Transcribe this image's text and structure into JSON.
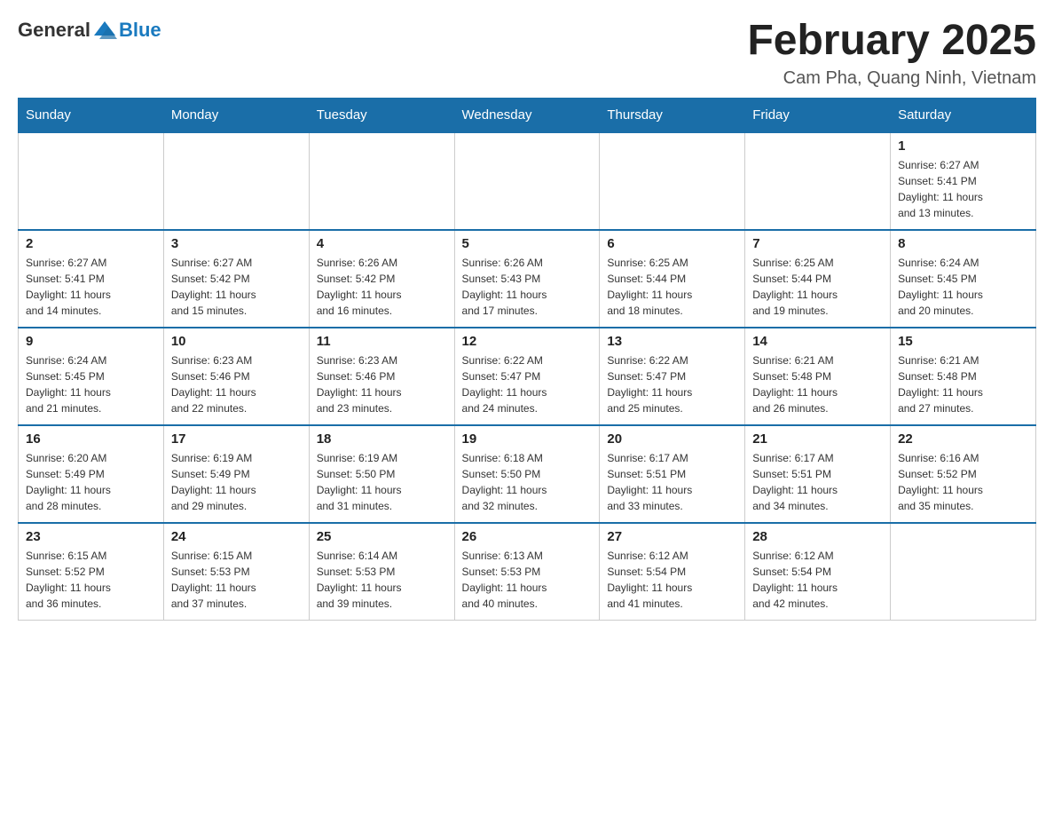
{
  "header": {
    "logo_general": "General",
    "logo_blue": "Blue",
    "month_title": "February 2025",
    "subtitle": "Cam Pha, Quang Ninh, Vietnam"
  },
  "weekdays": [
    "Sunday",
    "Monday",
    "Tuesday",
    "Wednesday",
    "Thursday",
    "Friday",
    "Saturday"
  ],
  "weeks": [
    [
      {
        "day": "",
        "info": ""
      },
      {
        "day": "",
        "info": ""
      },
      {
        "day": "",
        "info": ""
      },
      {
        "day": "",
        "info": ""
      },
      {
        "day": "",
        "info": ""
      },
      {
        "day": "",
        "info": ""
      },
      {
        "day": "1",
        "info": "Sunrise: 6:27 AM\nSunset: 5:41 PM\nDaylight: 11 hours\nand 13 minutes."
      }
    ],
    [
      {
        "day": "2",
        "info": "Sunrise: 6:27 AM\nSunset: 5:41 PM\nDaylight: 11 hours\nand 14 minutes."
      },
      {
        "day": "3",
        "info": "Sunrise: 6:27 AM\nSunset: 5:42 PM\nDaylight: 11 hours\nand 15 minutes."
      },
      {
        "day": "4",
        "info": "Sunrise: 6:26 AM\nSunset: 5:42 PM\nDaylight: 11 hours\nand 16 minutes."
      },
      {
        "day": "5",
        "info": "Sunrise: 6:26 AM\nSunset: 5:43 PM\nDaylight: 11 hours\nand 17 minutes."
      },
      {
        "day": "6",
        "info": "Sunrise: 6:25 AM\nSunset: 5:44 PM\nDaylight: 11 hours\nand 18 minutes."
      },
      {
        "day": "7",
        "info": "Sunrise: 6:25 AM\nSunset: 5:44 PM\nDaylight: 11 hours\nand 19 minutes."
      },
      {
        "day": "8",
        "info": "Sunrise: 6:24 AM\nSunset: 5:45 PM\nDaylight: 11 hours\nand 20 minutes."
      }
    ],
    [
      {
        "day": "9",
        "info": "Sunrise: 6:24 AM\nSunset: 5:45 PM\nDaylight: 11 hours\nand 21 minutes."
      },
      {
        "day": "10",
        "info": "Sunrise: 6:23 AM\nSunset: 5:46 PM\nDaylight: 11 hours\nand 22 minutes."
      },
      {
        "day": "11",
        "info": "Sunrise: 6:23 AM\nSunset: 5:46 PM\nDaylight: 11 hours\nand 23 minutes."
      },
      {
        "day": "12",
        "info": "Sunrise: 6:22 AM\nSunset: 5:47 PM\nDaylight: 11 hours\nand 24 minutes."
      },
      {
        "day": "13",
        "info": "Sunrise: 6:22 AM\nSunset: 5:47 PM\nDaylight: 11 hours\nand 25 minutes."
      },
      {
        "day": "14",
        "info": "Sunrise: 6:21 AM\nSunset: 5:48 PM\nDaylight: 11 hours\nand 26 minutes."
      },
      {
        "day": "15",
        "info": "Sunrise: 6:21 AM\nSunset: 5:48 PM\nDaylight: 11 hours\nand 27 minutes."
      }
    ],
    [
      {
        "day": "16",
        "info": "Sunrise: 6:20 AM\nSunset: 5:49 PM\nDaylight: 11 hours\nand 28 minutes."
      },
      {
        "day": "17",
        "info": "Sunrise: 6:19 AM\nSunset: 5:49 PM\nDaylight: 11 hours\nand 29 minutes."
      },
      {
        "day": "18",
        "info": "Sunrise: 6:19 AM\nSunset: 5:50 PM\nDaylight: 11 hours\nand 31 minutes."
      },
      {
        "day": "19",
        "info": "Sunrise: 6:18 AM\nSunset: 5:50 PM\nDaylight: 11 hours\nand 32 minutes."
      },
      {
        "day": "20",
        "info": "Sunrise: 6:17 AM\nSunset: 5:51 PM\nDaylight: 11 hours\nand 33 minutes."
      },
      {
        "day": "21",
        "info": "Sunrise: 6:17 AM\nSunset: 5:51 PM\nDaylight: 11 hours\nand 34 minutes."
      },
      {
        "day": "22",
        "info": "Sunrise: 6:16 AM\nSunset: 5:52 PM\nDaylight: 11 hours\nand 35 minutes."
      }
    ],
    [
      {
        "day": "23",
        "info": "Sunrise: 6:15 AM\nSunset: 5:52 PM\nDaylight: 11 hours\nand 36 minutes."
      },
      {
        "day": "24",
        "info": "Sunrise: 6:15 AM\nSunset: 5:53 PM\nDaylight: 11 hours\nand 37 minutes."
      },
      {
        "day": "25",
        "info": "Sunrise: 6:14 AM\nSunset: 5:53 PM\nDaylight: 11 hours\nand 39 minutes."
      },
      {
        "day": "26",
        "info": "Sunrise: 6:13 AM\nSunset: 5:53 PM\nDaylight: 11 hours\nand 40 minutes."
      },
      {
        "day": "27",
        "info": "Sunrise: 6:12 AM\nSunset: 5:54 PM\nDaylight: 11 hours\nand 41 minutes."
      },
      {
        "day": "28",
        "info": "Sunrise: 6:12 AM\nSunset: 5:54 PM\nDaylight: 11 hours\nand 42 minutes."
      },
      {
        "day": "",
        "info": ""
      }
    ]
  ]
}
